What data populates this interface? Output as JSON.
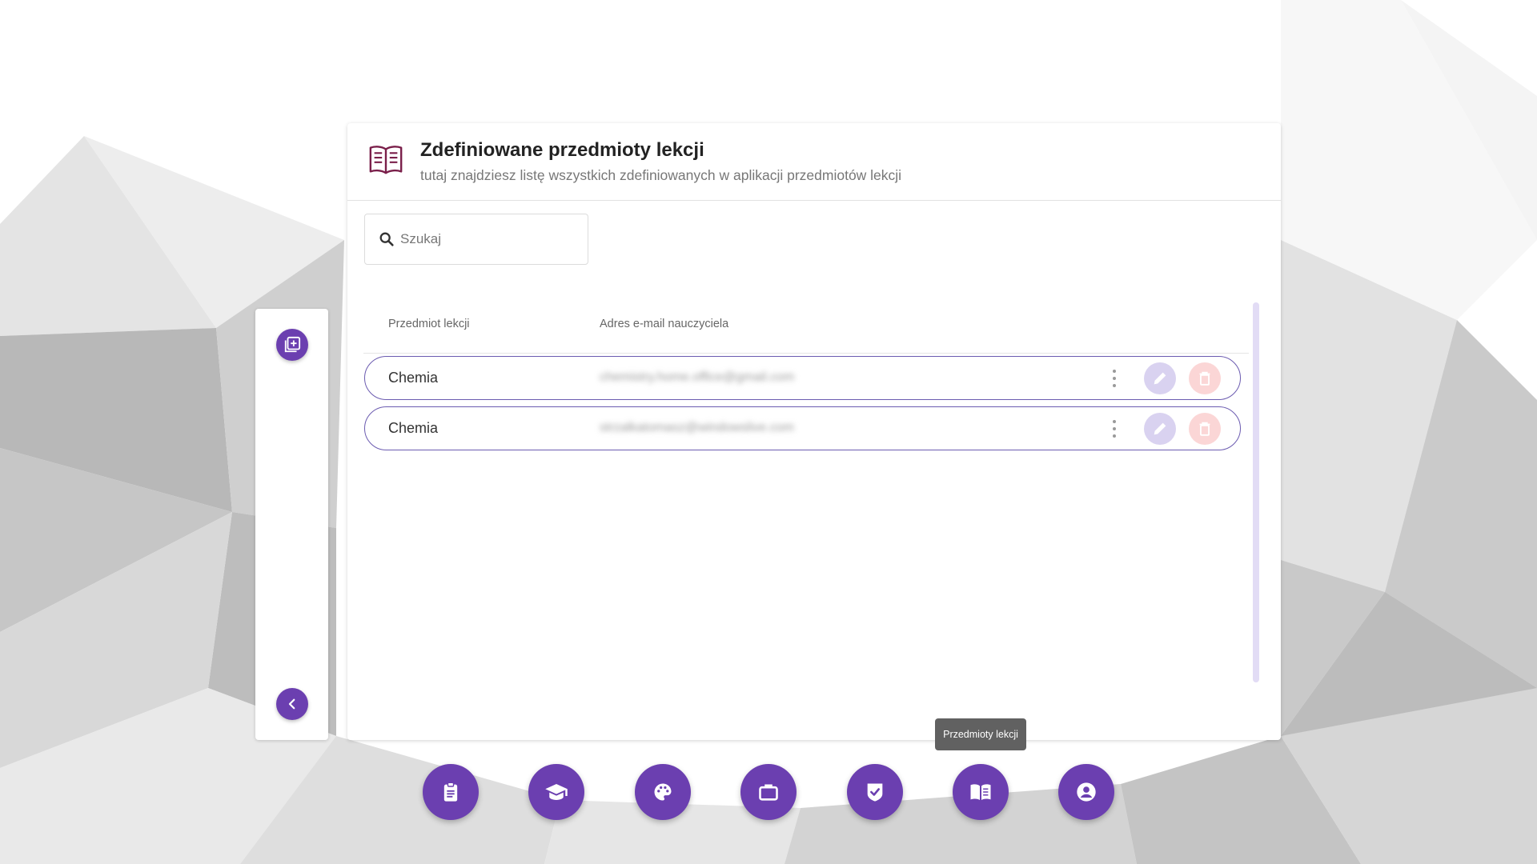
{
  "page": {
    "title": "Zdefiniowane przedmioty lekcji",
    "subtitle": "tutaj znajdziesz listę wszystkich zdefiniowanych w aplikacji przedmiotów lekcji",
    "header_icon": "book-outline-icon"
  },
  "search": {
    "placeholder": "Szukaj",
    "value": ""
  },
  "table": {
    "columns": [
      "Przedmiot lekcji",
      "Adres e-mail nauczyciela"
    ],
    "rows": [
      {
        "subject": "Chemia",
        "email": "chemistry.home.office@gmail.com"
      },
      {
        "subject": "Chemia",
        "email": "strzalkatomasz@windowslive.com"
      }
    ]
  },
  "side_panel": {
    "add_icon": "library-add-icon",
    "collapse_icon": "chevron-left-icon"
  },
  "bottom_nav": {
    "items": [
      {
        "icon": "clipboard-icon"
      },
      {
        "icon": "graduation-cap-icon"
      },
      {
        "icon": "palette-icon"
      },
      {
        "icon": "briefcase-icon"
      },
      {
        "icon": "shield-check-icon"
      },
      {
        "icon": "book-open-icon",
        "active": true
      },
      {
        "icon": "account-circle-icon"
      }
    ],
    "tooltip": "Przedmioty lekcji"
  },
  "colors": {
    "accent": "#6b3fb0",
    "header_icon": "#7a1f4a",
    "row_border": "#6b5bb0",
    "edit_bg": "#d9d2f0",
    "delete_bg": "#fbd6d6"
  }
}
